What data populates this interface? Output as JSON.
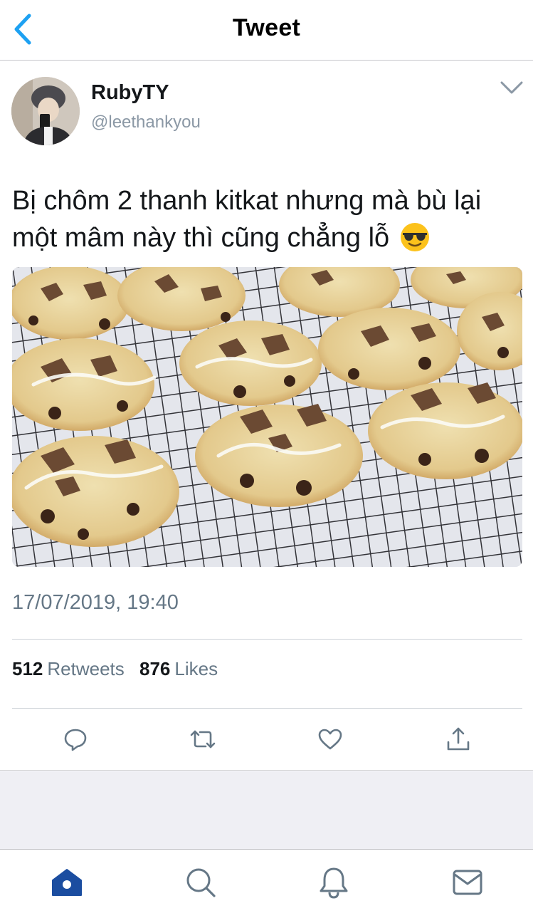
{
  "nav": {
    "title": "Tweet",
    "back_icon": "chevron-left-icon"
  },
  "tweet": {
    "display_name": "RubyTY",
    "handle": "@leethankyou",
    "text": "Bị chôm 2 thanh kitkat nhưng mà bù lại một mâm này thì cũng chẳng lỗ",
    "emoji": "smiling-face-with-sunglasses",
    "timestamp": "17/07/2019, 19:40",
    "retweets_count": "512",
    "retweets_label": "Retweets",
    "likes_count": "876",
    "likes_label": "Likes"
  },
  "actions": [
    "reply-icon",
    "retweet-icon",
    "like-icon",
    "share-icon"
  ],
  "tabbar": [
    "home-icon",
    "search-icon",
    "notifications-icon",
    "messages-icon"
  ],
  "colors": {
    "accent": "#1da1f2",
    "tab_active": "#1b4da0",
    "icon_gray": "#657786",
    "text_secondary": "#657786"
  }
}
